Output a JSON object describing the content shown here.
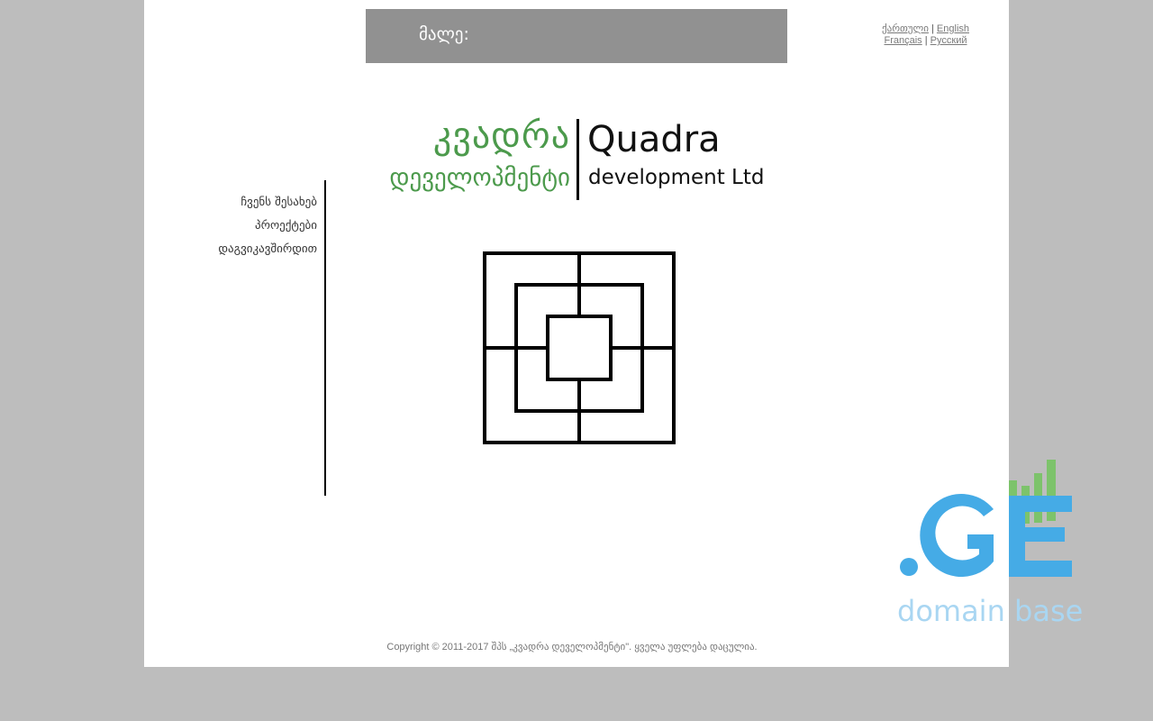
{
  "banner": {
    "text": "მალე:"
  },
  "language_switcher": {
    "items": [
      "ქართული",
      "English",
      "Français",
      "Русский"
    ],
    "separator": "|"
  },
  "logo": {
    "georgian_line1": "კვადრა",
    "georgian_line2": "დეველოპმენტი",
    "english_line1": "Quadra",
    "english_line2": "development Ltd"
  },
  "sidebar": {
    "items": [
      {
        "label": "ჩვენს შესახებ"
      },
      {
        "label": "პროექტები"
      },
      {
        "label": "დაგვიკავშირდით"
      }
    ]
  },
  "footer": {
    "copyright": "Copyright © 2011-2017 შპს „კვადრა დეველოპმენტი\". ყველა უფლება დაცულია."
  },
  "ge_badge": {
    "text": "domain base",
    "colors": {
      "blue": "#45abe6",
      "green": "#7dc36b",
      "light_blue": "#a9d6f2"
    }
  },
  "colors": {
    "background": "#bdbdbd",
    "page": "#ffffff",
    "banner": "#919191",
    "logo_green": "#4c9a4c"
  }
}
